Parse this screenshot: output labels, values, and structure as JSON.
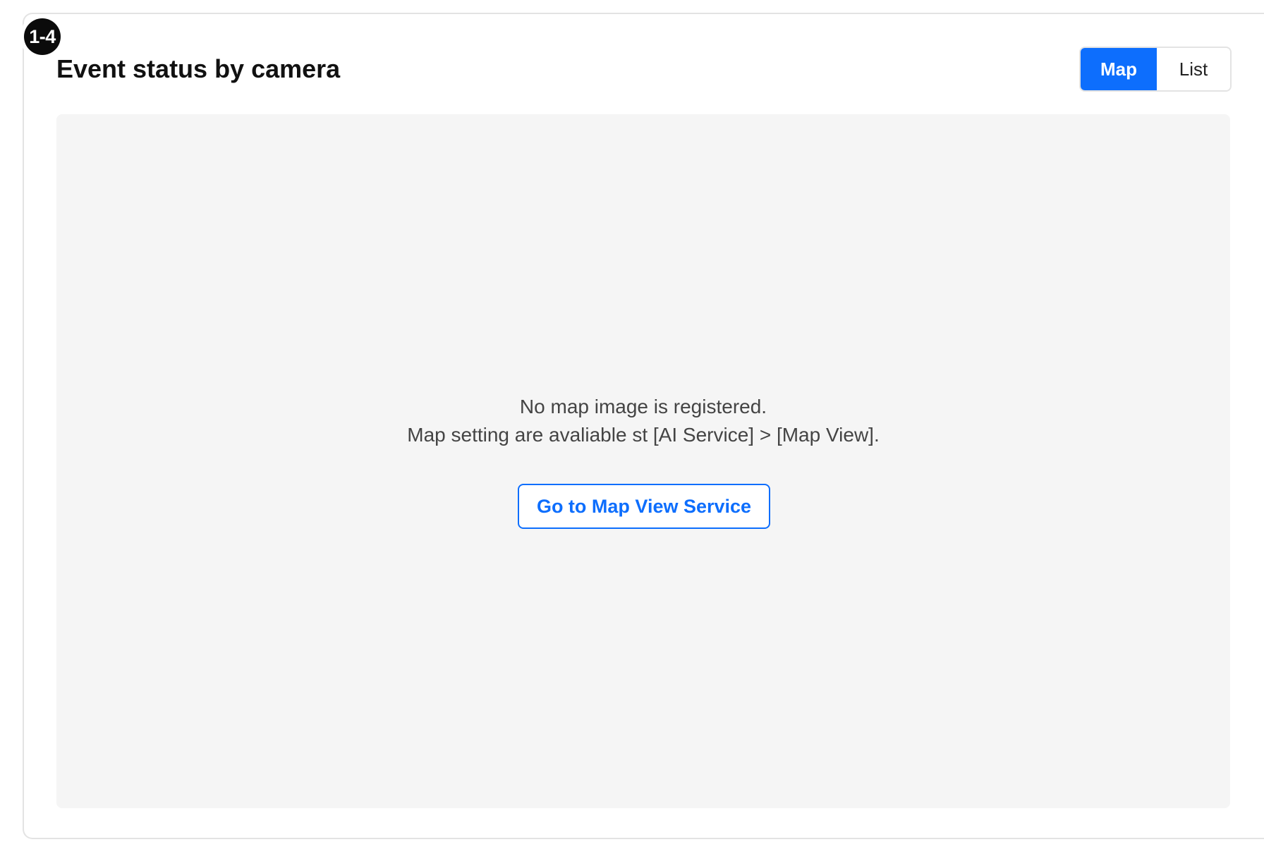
{
  "badge": {
    "label": "1-4"
  },
  "card": {
    "title": "Event status by camera"
  },
  "view_toggle": {
    "selected": "Map",
    "options": [
      "Map",
      "List"
    ],
    "map_label": "Map",
    "list_label": "List"
  },
  "map_area": {
    "message_line1": "No map image is registered.",
    "message_line2": "Map setting are avaliable st [AI Service] > [Map View].",
    "button_label": "Go to Map View Service"
  },
  "colors": {
    "accent": "#0d6efd",
    "badge_bg": "#0b0b0b",
    "panel_bg": "#f5f5f5",
    "border": "#e3e3e3"
  }
}
